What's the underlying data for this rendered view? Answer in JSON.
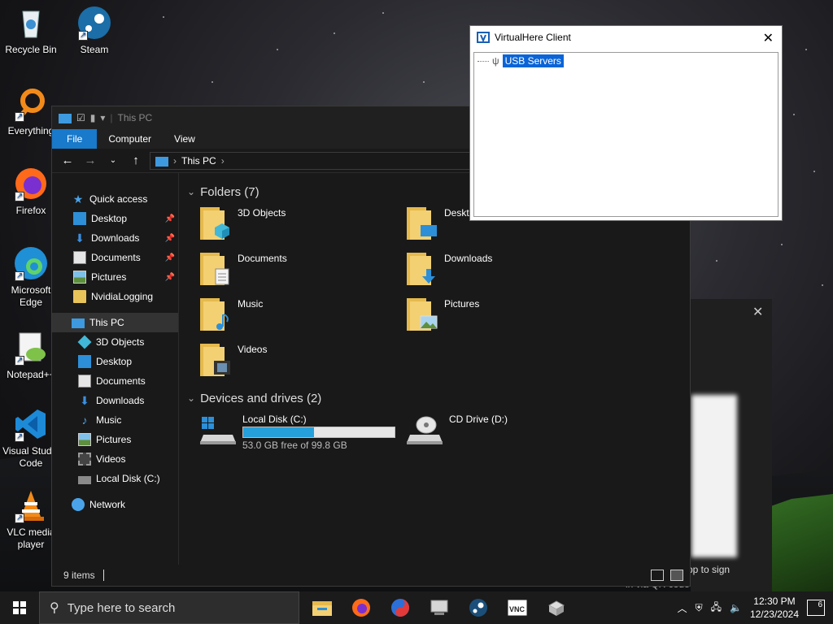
{
  "desktop": {
    "icons": [
      {
        "label": "Recycle Bin"
      },
      {
        "label": "Steam"
      },
      {
        "label": "Everything"
      },
      {
        "label": "Firefox"
      },
      {
        "label": "Microsoft Edge"
      },
      {
        "label": "Notepad++"
      },
      {
        "label": "Visual Studio Code"
      },
      {
        "label": "VLC media player"
      }
    ]
  },
  "explorer": {
    "title": "This PC",
    "ribbon_tabs": [
      "File",
      "Computer",
      "View"
    ],
    "address": "This PC",
    "nav": {
      "quick_access": "Quick access",
      "quick_items": [
        "Desktop",
        "Downloads",
        "Documents",
        "Pictures",
        "NvidiaLogging"
      ],
      "this_pc": "This PC",
      "pc_items": [
        "3D Objects",
        "Desktop",
        "Documents",
        "Downloads",
        "Music",
        "Pictures",
        "Videos",
        "Local Disk (C:)"
      ],
      "network": "Network"
    },
    "folders_header": "Folders (7)",
    "folders": [
      "3D Objects",
      "Desktop",
      "Documents",
      "Downloads",
      "Music",
      "Pictures",
      "Videos"
    ],
    "drives_header": "Devices and drives (2)",
    "drives": [
      {
        "name": "Local Disk (C:)",
        "free_text": "53.0 GB free of 99.8 GB",
        "used_fraction": 0.469
      },
      {
        "name": "CD Drive (D:)"
      }
    ],
    "status": "9 items"
  },
  "virtualhere": {
    "title": "VirtualHere Client",
    "node": "USB Servers"
  },
  "signin": {
    "text1": "pp to sign",
    "text2": "in via QR code"
  },
  "taskbar": {
    "search_placeholder": "Type here to search",
    "time": "12:30 PM",
    "date": "12/23/2024",
    "notifications": "6"
  }
}
